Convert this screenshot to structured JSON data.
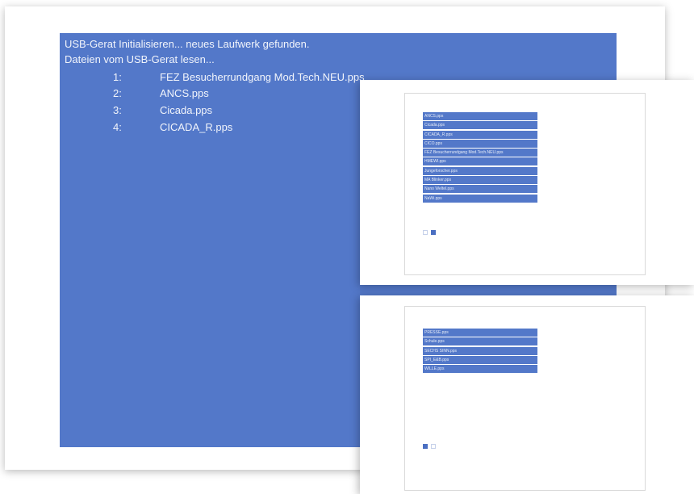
{
  "main_screen": {
    "status_line_1": "USB-Gerat Initialisieren... neues Laufwerk gefunden.",
    "status_line_2": "Dateien vom USB-Gerat lesen...",
    "files": [
      {
        "number": "1:",
        "name": "FEZ Besucherrundgang Mod.Tech.NEU.pps"
      },
      {
        "number": "2:",
        "name": "ANCS.pps"
      },
      {
        "number": "3:",
        "name": "Cicada.pps"
      },
      {
        "number": "4:",
        "name": "CICADA_R.pps"
      }
    ]
  },
  "panel_page_1": {
    "items": [
      "ANCS.pps",
      "Cicada.pps",
      "CICADA_R.pps",
      "CICO.pps",
      "FEZ Besucherrundgang Mod.Tech.NEU.pps",
      "HMEWI.pps",
      "Jungeforscher.pps",
      "MA Blinker.pps",
      "Nano Weltel.pps",
      "NaWi.pps"
    ],
    "active_page": 2
  },
  "panel_page_2": {
    "items": [
      "PRESSE.pps",
      "Schule.pps",
      "SECHS SINN.pps",
      "SPI_E&B.pps",
      "WILLE.pps"
    ],
    "active_page": 1
  },
  "colors": {
    "screen_blue": "#5378c9",
    "pager_active": "#4b6fc2"
  }
}
